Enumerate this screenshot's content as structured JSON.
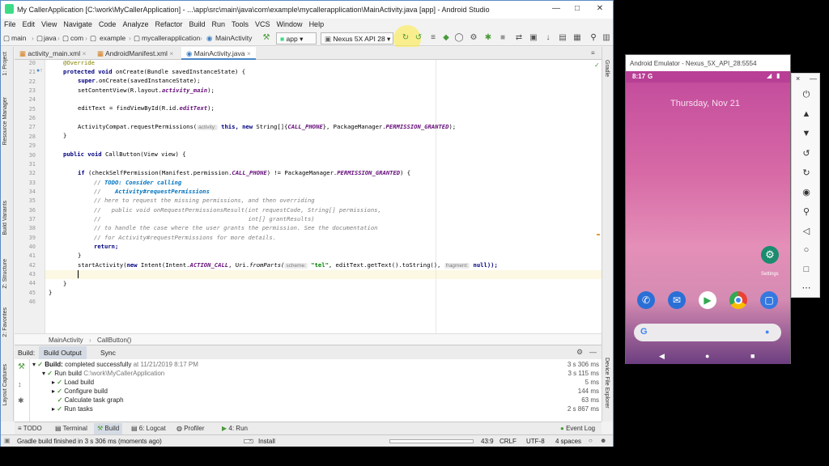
{
  "window_title": "My CallerApplication [C:\\work\\MyCallerApplication] - ...\\app\\src\\main\\java\\com\\example\\mycallerapplication\\MainActivity.java [app] - Android Studio",
  "menu": [
    "File",
    "Edit",
    "View",
    "Navigate",
    "Code",
    "Analyze",
    "Refactor",
    "Build",
    "Run",
    "Tools",
    "VCS",
    "Window",
    "Help"
  ],
  "breadcrumbs": [
    "main",
    "java",
    "com",
    "example",
    "mycallerapplication",
    "MainActivity"
  ],
  "run_config": "app",
  "device": "Nexus 5X API 28",
  "left_tabs": [
    "1: Project",
    "Resource Manager",
    "Build Variants",
    "Z: Structure",
    "2: Favorites",
    "Layout Captures"
  ],
  "right_tabs": [
    "Gradle",
    "Device File Explorer"
  ],
  "file_tabs": [
    "activity_main.xml",
    "AndroidManifest.xml",
    "MainActivity.java"
  ],
  "line_numbers": [
    "20",
    "21",
    "22",
    "23",
    "24",
    "25",
    "26",
    "27",
    "28",
    "29",
    "30",
    "31",
    "32",
    "33",
    "34",
    "35",
    "36",
    "37",
    "38",
    "39",
    "40",
    "41",
    "42",
    "43",
    "44",
    "45",
    "46"
  ],
  "code": {
    "l20": "@Override",
    "l21a": "protected void ",
    "l21b": "onCreate(Bundle savedInstanceState) {",
    "l22a": "super",
    ".l22b": "",
    "l22": ".onCreate(savedInstanceState);",
    "l23a": "setContentView(R.layout.",
    "l23b": "activity_main",
    "l23c": ");",
    "l25a": "editText = findViewById(R.id.",
    "l25b": "editText",
    "l25c": ");",
    "l27a": "ActivityCompat.requestPermissions(",
    "l27h": "activity:",
    "l27b": " this, ",
    "l27c": "new ",
    "l27d": "String[]{",
    "l27e": "CALL_PHONE",
    "l27f": "}, PackageManager.",
    "l27g": "PERMISSION_GRANTED",
    "l27i": ");",
    "l28": "}",
    "l30a": "public void ",
    "l30b": "CallButton(View view) {",
    "l32a": "if ",
    "l32b": "(checkSelfPermission(Manifest.permission.",
    "l32c": "CALL_PHONE",
    "l32d": ") != PackageManager.",
    "l32e": "PERMISSION_GRANTED",
    "l32f": ") {",
    "l33a": "// ",
    "l33b": "TODO: Consider calling",
    "l34a": "//    ",
    "l34b": "Activity#requestPermissions",
    "l35": "// here to request the missing permissions, and then overriding",
    "l36": "//   public void onRequestPermissionsResult(int requestCode, String[] permissions,",
    "l37": "//                                          int[] grantResults)",
    "l38": "// to handle the case where the user grants the permission. See the documentation",
    "l39": "// for Activity#requestPermissions for more details.",
    "l40": "return;",
    "l41": "}",
    "l42a": "startActivity(",
    "l42b": "new ",
    "l42c": "Intent(Intent.",
    "l42d": "ACTION_CALL",
    "l42e": ", Uri.",
    "l42f": "fromParts(",
    "l42h1": "scheme:",
    "l42g": " \"tel\"",
    ", ": "",
    "l42i": ", editText.getText().toString(), ",
    "l42h2": "fragment:",
    "l42j": " null));",
    "l44": "}",
    "l45": "}"
  },
  "editor_breadcrumb": [
    "MainActivity",
    "CallButton()"
  ],
  "build_tabs": [
    "Build:",
    "Build Output",
    "Sync"
  ],
  "build_rows": [
    {
      "label": "Build:",
      "text": " completed successfully",
      "extra": " at 11/21/2019 8:17 PM",
      "time": "3 s 306 ms"
    },
    {
      "label": "Run build",
      "text": "",
      "extra": " C:\\work\\MyCallerApplication",
      "time": "3 s 115 ms"
    },
    {
      "label": "Load build",
      "text": "",
      "extra": "",
      "time": "5 ms"
    },
    {
      "label": "Configure build",
      "text": "",
      "extra": "",
      "time": "144 ms"
    },
    {
      "label": "Calculate task graph",
      "text": "",
      "extra": "",
      "time": "63 ms"
    },
    {
      "label": "Run tasks",
      "text": "",
      "extra": "",
      "time": "2 s 867 ms"
    }
  ],
  "bottom_tabs": [
    "TODO",
    "Terminal",
    "Build",
    "6: Logcat",
    "Profiler",
    "4: Run"
  ],
  "event_log": "Event Log",
  "status": {
    "message": "Gradle build finished in 3 s 306 ms (moments ago)",
    "install": "Install",
    "position": "43:9",
    "line_sep": "CRLF",
    "encoding": "UTF-8",
    "indent": "4 spaces"
  },
  "emulator": {
    "title": "Android Emulator - Nexus_5X_API_28:5554",
    "time": "8:17",
    "g": "G",
    "date": "Thursday, Nov 21",
    "settings_label": "Settings"
  },
  "colors": {
    "accent": "#4a88c7",
    "success": "#4a9a3a",
    "gradient_top": "#c24a9c"
  }
}
